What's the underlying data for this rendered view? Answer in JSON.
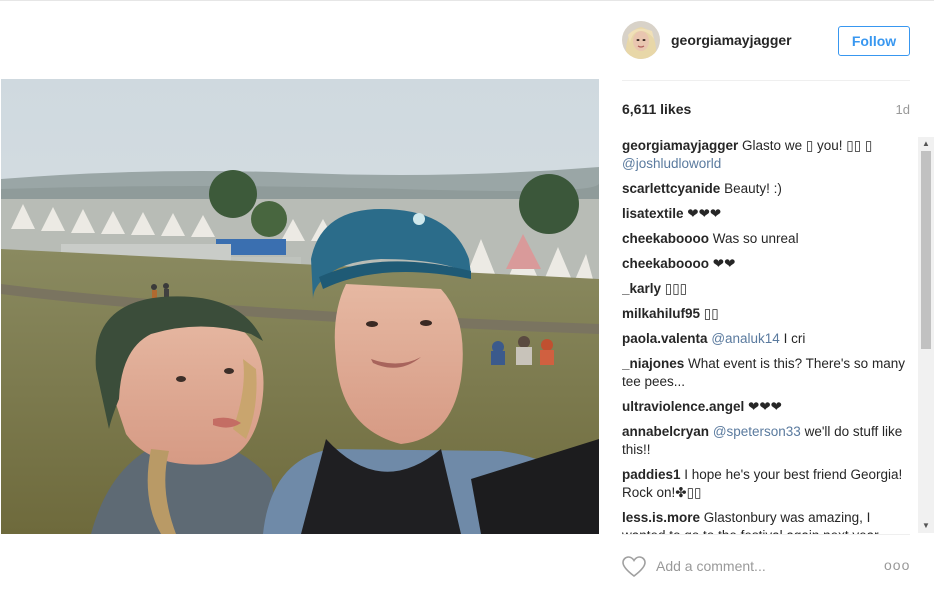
{
  "post": {
    "username": "georgiamayjagger",
    "follow_label": "Follow",
    "likes": "6,611 likes",
    "age": "1d",
    "comment_placeholder": "Add a comment...",
    "more_label": "ooo"
  },
  "comments": [
    {
      "user": "georgiamayjagger",
      "text": " Glasto we ▯ you! ▯▯ ▯ ",
      "mention": "@joshludloworld",
      "after": ""
    },
    {
      "user": "scarlettcyanide",
      "text": " Beauty! :)",
      "mention": "",
      "after": ""
    },
    {
      "user": "lisatextile",
      "text": " ❤❤❤",
      "mention": "",
      "after": ""
    },
    {
      "user": "cheekaboooo",
      "text": " Was so unreal",
      "mention": "",
      "after": ""
    },
    {
      "user": "cheekaboooo",
      "text": " ❤❤",
      "mention": "",
      "after": ""
    },
    {
      "user": "_karly",
      "text": " ▯▯▯",
      "mention": "",
      "after": ""
    },
    {
      "user": "milkahiluf95",
      "text": " ▯▯",
      "mention": "",
      "after": ""
    },
    {
      "user": "paola.valenta",
      "text": " ",
      "mention": "@analuk14",
      "after": " I cri"
    },
    {
      "user": "_niajones",
      "text": " What event is this? There's so many tee pees...",
      "mention": "",
      "after": ""
    },
    {
      "user": "ultraviolence.angel",
      "text": " ❤❤❤",
      "mention": "",
      "after": ""
    },
    {
      "user": "annabelcryan",
      "text": " ",
      "mention": "@speterson33",
      "after": " we'll do stuff like this!!"
    },
    {
      "user": "paddies1",
      "text": " I hope he's your best friend Georgia! Rock on!✤▯▯",
      "mention": "",
      "after": ""
    },
    {
      "user": "less.is.more",
      "text": " Glastonbury was amazing, I wanted to go to the festival again next year",
      "mention": "",
      "after": ""
    }
  ],
  "icons": {
    "heart": "heart-outline-icon",
    "more": "more-options-icon",
    "scroll_up": "scroll-up-arrow-icon",
    "scroll_down": "scroll-down-arrow-icon"
  },
  "colors": {
    "follow": "#3897f0",
    "mention": "#5a7a9e",
    "text": "#262626",
    "muted": "#999999"
  }
}
